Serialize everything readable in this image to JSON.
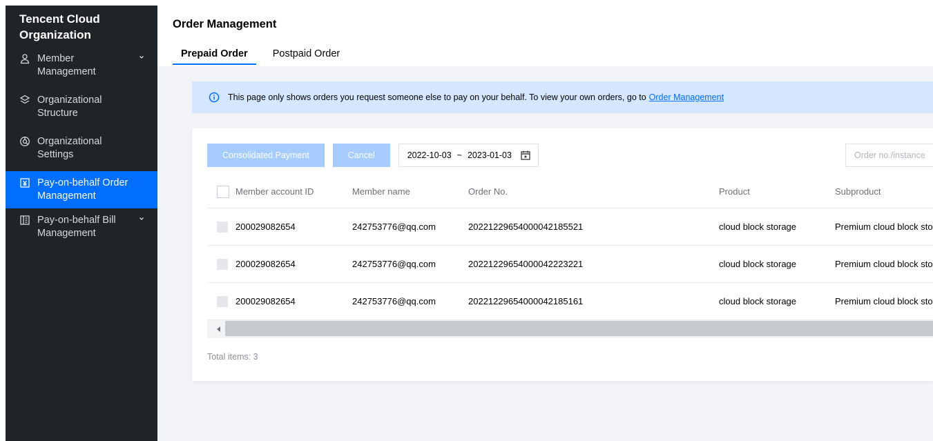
{
  "sidebar": {
    "title": "Tencent Cloud Organization",
    "items": [
      {
        "label": "Member Management",
        "icon": "user-icon",
        "has_chevron": true
      },
      {
        "label": "Organizational Structure",
        "icon": "structure-icon"
      },
      {
        "label": "Organizational Settings",
        "icon": "settings-icon"
      },
      {
        "label": "Pay-on-behalf Order Management",
        "icon": "order-icon",
        "active": true
      },
      {
        "label": "Pay-on-behalf Bill Management",
        "icon": "bill-icon",
        "has_chevron": true
      }
    ]
  },
  "header": {
    "title": "Order Management",
    "tabs": [
      {
        "label": "Prepaid Order",
        "active": true
      },
      {
        "label": "Postpaid Order"
      }
    ]
  },
  "notice": {
    "text": "This page only shows orders you request someone else to pay on your behalf. To view your own orders, go to",
    "link": "Order Management"
  },
  "toolbar": {
    "consolidated_label": "Consolidated Payment",
    "cancel_label": "Cancel",
    "date_start": "2022-10-03",
    "date_sep": "~",
    "date_end": "2023-01-03",
    "search_placeholder": "Order no./instance"
  },
  "table": {
    "columns": [
      "Member account ID",
      "Member name",
      "Order No.",
      "Product",
      "Subproduct"
    ],
    "rows": [
      {
        "account_id": "200029082654",
        "member_name": "242753776@qq.com",
        "order_no": "20221229654000042185521",
        "product": "cloud block storage",
        "subproduct": "Premium cloud block sto"
      },
      {
        "account_id": "200029082654",
        "member_name": "242753776@qq.com",
        "order_no": "20221229654000042223221",
        "product": "cloud block storage",
        "subproduct": "Premium cloud block sto"
      },
      {
        "account_id": "200029082654",
        "member_name": "242753776@qq.com",
        "order_no": "20221229654000042185161",
        "product": "cloud block storage",
        "subproduct": "Premium cloud block sto"
      }
    ]
  },
  "footer": {
    "total": "Total items: 3"
  },
  "colors": {
    "accent": "#006eff",
    "sidebar_bg": "#1f2429",
    "notice_bg": "#d5e7ff",
    "button_disabled": "#a7ccff"
  }
}
